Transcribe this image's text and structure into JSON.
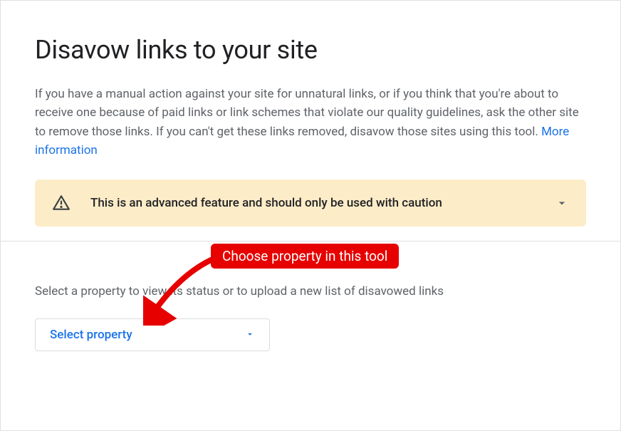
{
  "header": {
    "title": "Disavow links to your site"
  },
  "description": {
    "text": "If you have a manual action against your site for unnatural links, or if you think that you're about to receive one because of paid links or link schemes that violate our quality guidelines, ask the other site to remove those links. If you can't get these links removed, disavow those sites using this tool. ",
    "link_text": "More information"
  },
  "warning": {
    "message": "This is an advanced feature and should only be used with caution"
  },
  "lower": {
    "instruction": "Select a property to view its status or to upload a new list of disavowed links",
    "select_label": "Select property"
  },
  "annotation": {
    "label": "Choose property in this tool"
  }
}
